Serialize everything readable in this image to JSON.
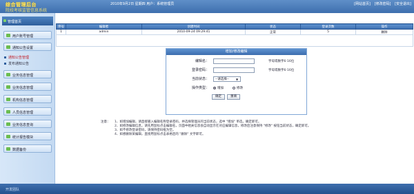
{
  "header": {
    "logo_line1": "综合管理后台",
    "logo_line2": "院校考核监管信息系统",
    "info": "2010年9月2日 星期四  用户：系统管理员",
    "links": [
      "[网站首页]",
      "[修改密码]",
      "[安全退出]"
    ]
  },
  "sidebar": {
    "title": "管理首页",
    "items": [
      {
        "label": "用户账号管理",
        "type": "button"
      },
      {
        "label": "通知公告设置",
        "type": "button"
      },
      {
        "label": "通知公告管理",
        "type": "tree",
        "active": true
      },
      {
        "label": "发布通知公告",
        "type": "tree",
        "active": false
      },
      {
        "label": "业务信息管理",
        "type": "button"
      },
      {
        "label": "业务信息管理",
        "type": "button"
      },
      {
        "label": "机构信息管理",
        "type": "button"
      },
      {
        "label": "人员信息管理",
        "type": "button"
      },
      {
        "label": "业务信息查询",
        "type": "button"
      },
      {
        "label": "统计报告模块",
        "type": "button"
      },
      {
        "label": "数据备份",
        "type": "button"
      }
    ]
  },
  "table": {
    "headers": [
      "序号",
      "编辑者",
      "创建时间",
      "状态",
      "登录次数",
      "操作"
    ],
    "rows": [
      [
        "1",
        "admin",
        "2010-09-24 09:29:41",
        "正常",
        "5",
        "删除"
      ]
    ]
  },
  "form": {
    "title": "增加/修改编辑",
    "fields": {
      "editor_label": "编辑名：",
      "editor_hint": "字母或数字6-16位",
      "password_label": "登录密码：",
      "password_hint": "字母或数字6-16位",
      "status_label": "当前状态：",
      "status_value": "--请选择--",
      "type_label": "操作类型：",
      "radio_add": "增加",
      "radio_edit": "修改"
    },
    "confirm": "确定",
    "reset": "重填"
  },
  "notes": {
    "heading": "注意：",
    "lines": [
      "1、如增加编辑，请直接输入编辑名称登录密码，并选择管理员的当前状态，选中 \"增加\" 单选，确定即可。",
      "2、如修改编辑信息，请先用鼠标点击编辑名，页面中相关信息会自动显示在对应编辑信息，修改后注意保持 \"修改\" 按钮当前状态，确定即可。",
      "3、如不修改登录密码，请保持密码框为空。",
      "4、如想删除某编辑，直接用鼠标点击表格后的 \"删除\" 文字即可。"
    ]
  },
  "footer": {
    "text": "开发团队"
  }
}
